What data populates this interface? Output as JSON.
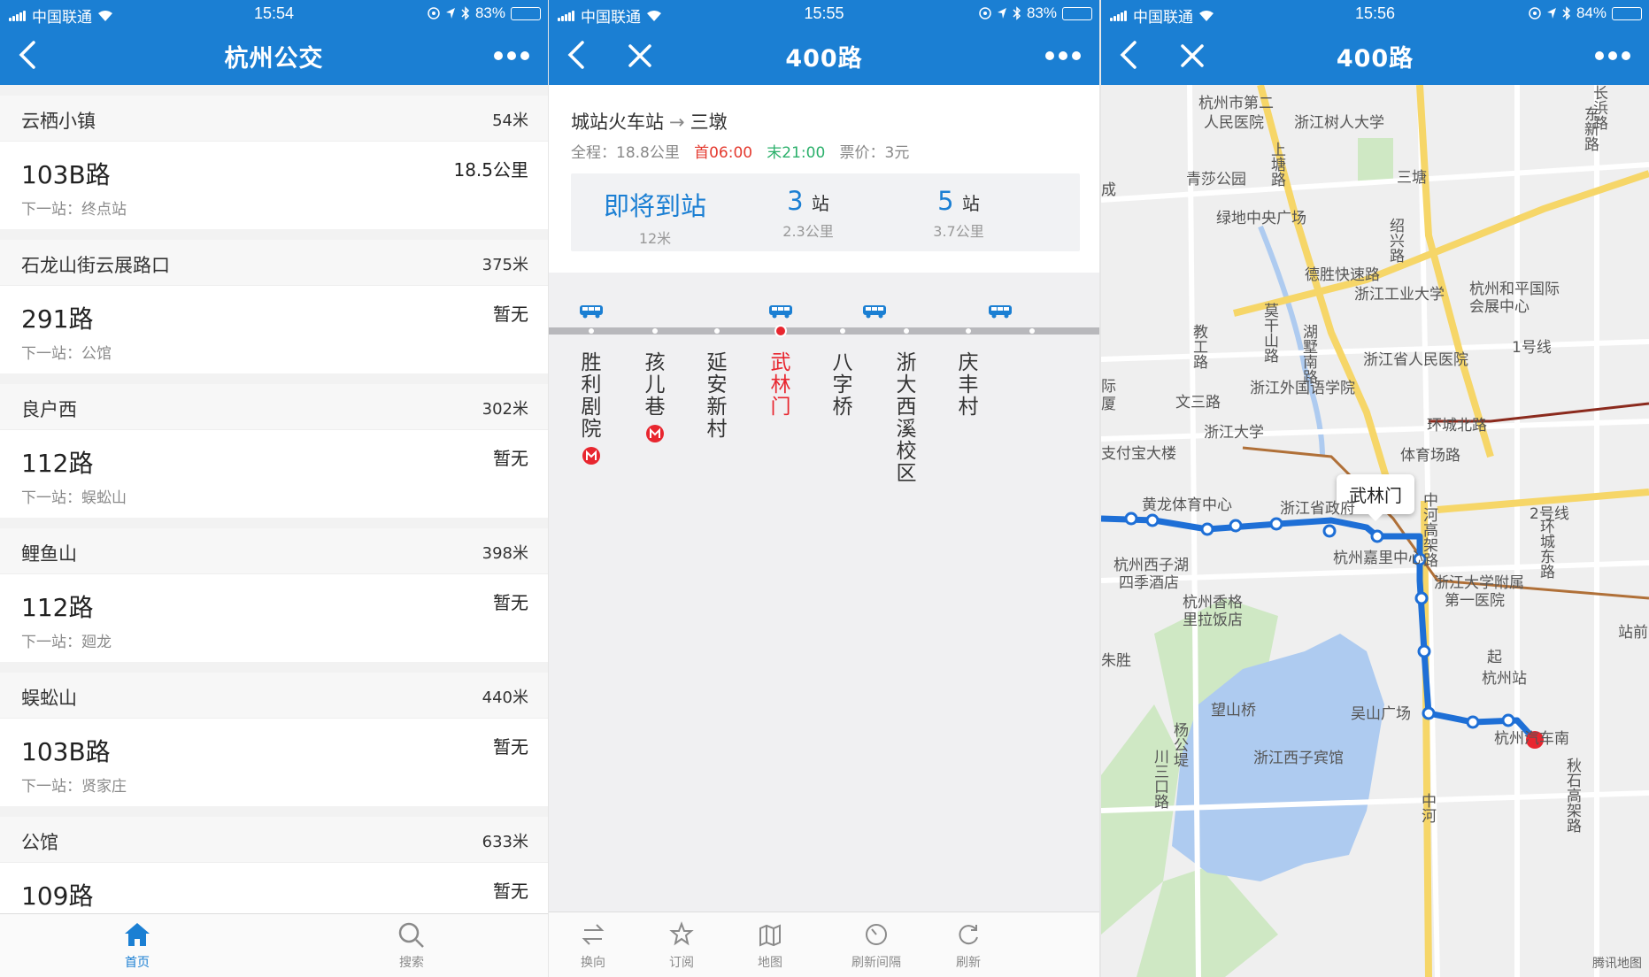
{
  "status_bars": [
    {
      "carrier": "中国联通",
      "time": "15:54",
      "battery": "83%",
      "battery_level": 0.83
    },
    {
      "carrier": "中国联通",
      "time": "15:55",
      "battery": "83%",
      "battery_level": 0.83
    },
    {
      "carrier": "中国联通",
      "time": "15:56",
      "battery": "84%",
      "battery_level": 0.84
    }
  ],
  "panel1": {
    "title": "杭州公交",
    "stops": [
      {
        "name": "云栖小镇",
        "distance": "54米",
        "route": "103B路",
        "route_status": "18.5公里",
        "next_stop": "下一站：终点站"
      },
      {
        "name": "石龙山街云展路口",
        "distance": "375米",
        "route": "291路",
        "route_status": "暂无",
        "next_stop": "下一站：公馆"
      },
      {
        "name": "良户西",
        "distance": "302米",
        "route": "112路",
        "route_status": "暂无",
        "next_stop": "下一站：蜈蚣山"
      },
      {
        "name": "鲤鱼山",
        "distance": "398米",
        "route": "112路",
        "route_status": "暂无",
        "next_stop": "下一站：廻龙"
      },
      {
        "name": "蜈蚣山",
        "distance": "440米",
        "route": "103B路",
        "route_status": "暂无",
        "next_stop": "下一站：贤家庄"
      },
      {
        "name": "公馆",
        "distance": "633米",
        "route": "109路",
        "route_status": "暂无",
        "next_stop": ""
      }
    ],
    "tabs": [
      {
        "label": "首页",
        "icon": "home-icon",
        "active": true
      },
      {
        "label": "搜索",
        "icon": "search-icon",
        "active": false
      }
    ]
  },
  "panel2": {
    "title": "400路",
    "from": "城站火车站",
    "arrow": "→",
    "to": "三墩",
    "meta": {
      "total_label": "全程：",
      "total": "18.8公里",
      "first_label": "首",
      "first": "06:00",
      "last_label": "末",
      "last": "21:00",
      "fare_label": "票价：",
      "fare": "3元"
    },
    "arrivals": [
      {
        "main": "即将到站",
        "unit": "",
        "sub": "12米"
      },
      {
        "main": "3",
        "unit": "站",
        "sub": "2.3公里"
      },
      {
        "main": "5",
        "unit": "站",
        "sub": "3.7公里"
      }
    ],
    "stops": [
      {
        "name": "胜利剧院",
        "metro": true,
        "current": false
      },
      {
        "name": "孩儿巷",
        "metro": true,
        "current": false
      },
      {
        "name": "延安新村",
        "metro": false,
        "current": false
      },
      {
        "name": "武林门",
        "metro": false,
        "current": true
      },
      {
        "name": "八字桥",
        "metro": false,
        "current": false
      },
      {
        "name": "浙大西溪校区",
        "metro": false,
        "current": false
      },
      {
        "name": "庆丰村",
        "metro": false,
        "current": false
      }
    ],
    "toolbar": [
      {
        "label": "换向",
        "icon": "swap-icon"
      },
      {
        "label": "订阅",
        "icon": "star-icon"
      },
      {
        "label": "地图",
        "icon": "map-icon"
      },
      {
        "label": "刷新间隔",
        "icon": "timer-icon"
      },
      {
        "label": "刷新",
        "icon": "refresh-icon"
      }
    ]
  },
  "panel3": {
    "title": "400路",
    "callout": "武林门",
    "watermark": "腾讯地图",
    "labels": {
      "l1": "杭州市第二",
      "l2": "人民医院",
      "l3": "浙江树人大学",
      "l4": "长浜路",
      "l5": "东新路",
      "l6": "青莎公园",
      "l7": "上塘路",
      "l8": "三塘",
      "l9": "成",
      "l10": "绿地中央广场",
      "l11": "绍兴路",
      "l12": "德胜快速路",
      "l13": "浙江工业大学",
      "l14": "杭州和平国际",
      "l15": "会展中心",
      "l16": "莫干山路",
      "l17": "湖墅南路",
      "l18": "教工路",
      "l19": "浙江省人民医院",
      "l20": "1号线",
      "l21": "际",
      "l22": "厦",
      "l23": "文三路",
      "l24": "浙江外国语学院",
      "l25": "浙江大学",
      "l26": "环城北路",
      "l27": "支付宝大楼",
      "l28": "体育场路",
      "l29": "黄龙体育中心",
      "l30": "浙江省政府",
      "l31": "中河高架路",
      "l32": "2号线",
      "l33": "环城东路",
      "l34": "杭州西子湖",
      "l35": "四季酒店",
      "l36": "杭州嘉里中心",
      "l37": "杭州香格",
      "l38": "里拉饭店",
      "l39": "浙江大学附属",
      "l40": "第一医院",
      "l41": "站前",
      "l42": "朱胜",
      "l43": "起",
      "l44": "杭州站",
      "l45": "望山桥",
      "l46": "吴山广场",
      "l47": "杨公堤",
      "l48": "浙江西子宾馆",
      "l49": "杭州汽车南",
      "l50": "川三口路",
      "l51": "秋石高架路",
      "l52": "中河"
    }
  },
  "colors": {
    "header_blue": "#1b7fd3",
    "route_blue": "#1e6fd6",
    "current_red": "#e8262f",
    "first_red": "#e43a2f",
    "last_green": "#2bb06b",
    "lake": "#aecbf0",
    "park": "#cfe8c4",
    "road_yellow": "#f6d668"
  }
}
